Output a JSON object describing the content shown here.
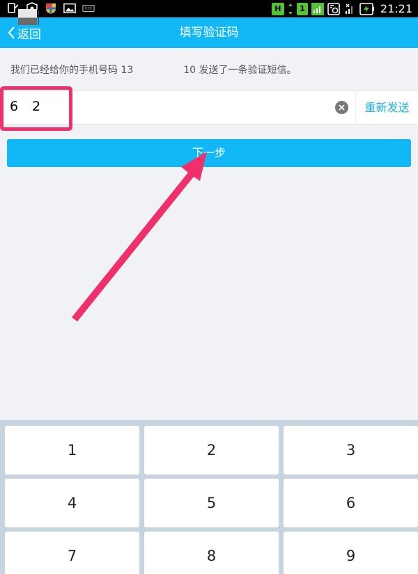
{
  "statusbar": {
    "time": "21:21",
    "icons": [
      "phone-message-icon",
      "shield-icon",
      "store-icon",
      "image-icon",
      "keyboard-icon",
      "h-network-icon",
      "sim-icon",
      "signal-icon",
      "sync-icon",
      "signal-weak-icon",
      "battery-charging-icon"
    ],
    "network_badge": "H",
    "sim_badge": "1"
  },
  "header": {
    "back_label": "返回",
    "title": "填写验证码"
  },
  "message": {
    "prefix": "我们已经给你的手机号码 13",
    "phone_tail": "10",
    "suffix": " 发送了一条验证短信。"
  },
  "code": {
    "visible_first": "6",
    "visible_last": "2",
    "resend_label": "重新发送"
  },
  "next_label": "下一步",
  "keypad": {
    "keys": [
      "1",
      "2",
      "3",
      "4",
      "5",
      "6",
      "7",
      "8",
      "9"
    ]
  },
  "colors": {
    "accent": "#12b7f5",
    "annotation": "#f0306c",
    "keypad_bg": "#c6d4df"
  }
}
